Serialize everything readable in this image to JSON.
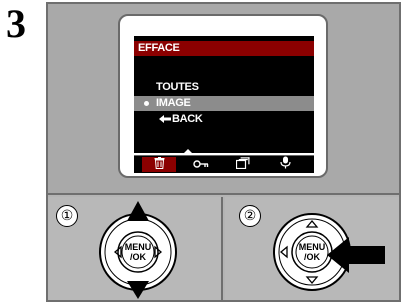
{
  "step": "3",
  "lcd": {
    "title": "EFFACE",
    "items": [
      {
        "label": "TOUTES",
        "selected": false
      },
      {
        "label": "IMAGE",
        "selected": true
      },
      {
        "label": "BACK",
        "selected": false
      }
    ],
    "tabs": [
      "trash-icon",
      "key-icon",
      "frames-icon",
      "microphone-icon"
    ],
    "active_tab": 0
  },
  "steps": [
    {
      "number": "①",
      "button_label": "MENU\n/OK",
      "hint": "press up/down arrows"
    },
    {
      "number": "②",
      "button_label": "MENU\n/OK",
      "hint": "press MENU/OK"
    }
  ],
  "colors": {
    "accent": "#8b0000",
    "highlight": "#8c8c8c",
    "panel": "#a9a9a9"
  }
}
